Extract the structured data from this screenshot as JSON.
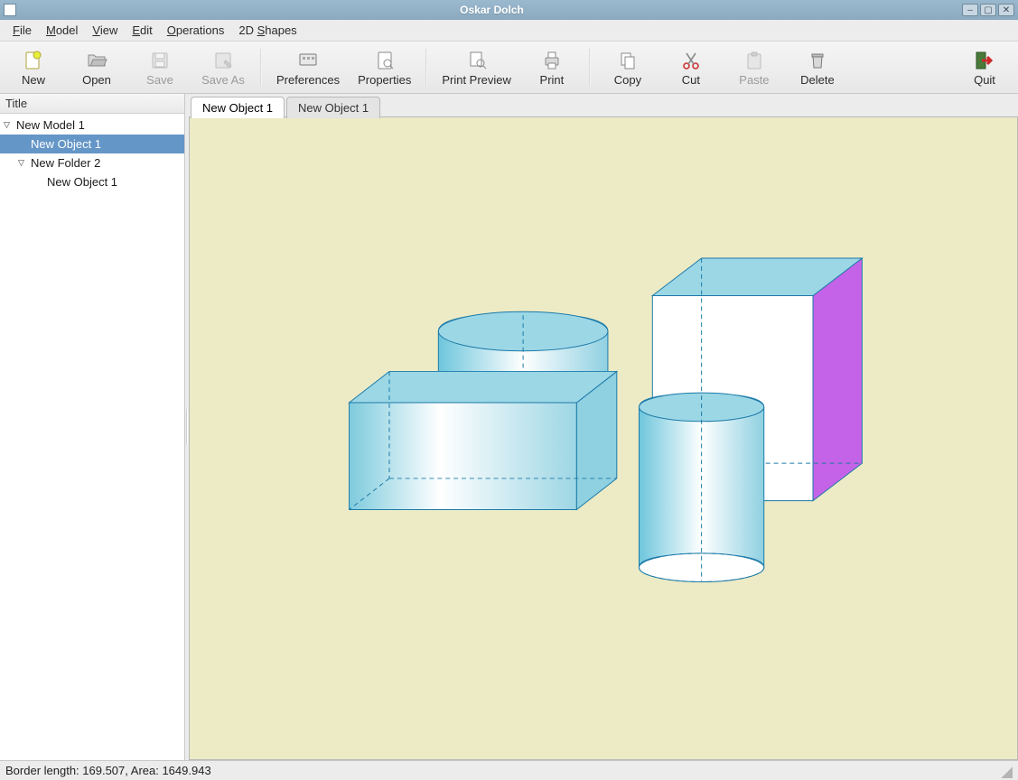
{
  "window": {
    "title": "Oskar Dolch"
  },
  "menus": {
    "file": "File",
    "model": "Model",
    "view": "View",
    "edit": "Edit",
    "operations": "Operations",
    "shapes2d": "2D Shapes"
  },
  "toolbar": {
    "new": "New",
    "open": "Open",
    "save": "Save",
    "save_as": "Save As",
    "preferences": "Preferences",
    "properties": "Properties",
    "print_preview": "Print Preview",
    "print": "Print",
    "copy": "Copy",
    "cut": "Cut",
    "paste": "Paste",
    "delete": "Delete",
    "quit": "Quit"
  },
  "sidebar": {
    "header": "Title",
    "tree": {
      "model": "New Model 1",
      "object1": "New Object 1",
      "folder": "New Folder 2",
      "object2": "New Object 1"
    }
  },
  "tabs": {
    "tab1": "New Object 1",
    "tab2": "New Object 1"
  },
  "status": {
    "text": "Border length: 169.507, Area: 1649.943"
  }
}
